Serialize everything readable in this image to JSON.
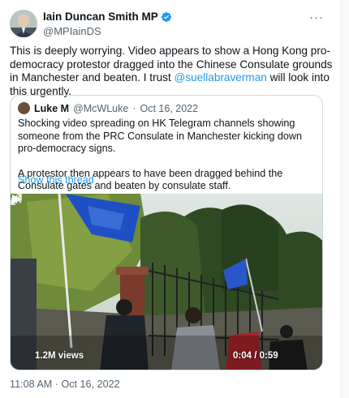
{
  "author": {
    "name": "Iain Duncan Smith MP",
    "handle": "@MPIainDS"
  },
  "tweet": {
    "text_before": "This is deeply worrying. Video appears to show a Hong Kong pro-democracy protestor dragged into the Chinese Consulate grounds in Manchester and beaten. I trust ",
    "mention": "@suellabraverman",
    "text_after": " will look into this urgently."
  },
  "quoted": {
    "name": "Luke M",
    "handle": "@McWLuke",
    "separator": "·",
    "date": "Oct 16, 2022",
    "paragraph1": "Shocking video spreading on HK Telegram channels showing someone from the PRC Consulate in Manchester kicking down pro-democracy signs.",
    "paragraph2": "A protestor then appears to have been dragged behind the Consulate gates and beaten by consulate staff.",
    "show_thread": "Show this thread",
    "video": {
      "views": "1.2M views",
      "elapsed": "0:04",
      "duration": "0:59",
      "time_separator": " / "
    }
  },
  "timestamp": "11:08 AM · Oct 16, 2022",
  "colors": {
    "accent": "#1d9bf0",
    "secondary_text": "#536471",
    "border": "#cfd9de"
  },
  "icons": {
    "verified": "verified-badge-icon",
    "more": "more-options-icon",
    "play": "play-icon",
    "volume": "volume-icon",
    "fullscreen": "fullscreen-icon"
  }
}
